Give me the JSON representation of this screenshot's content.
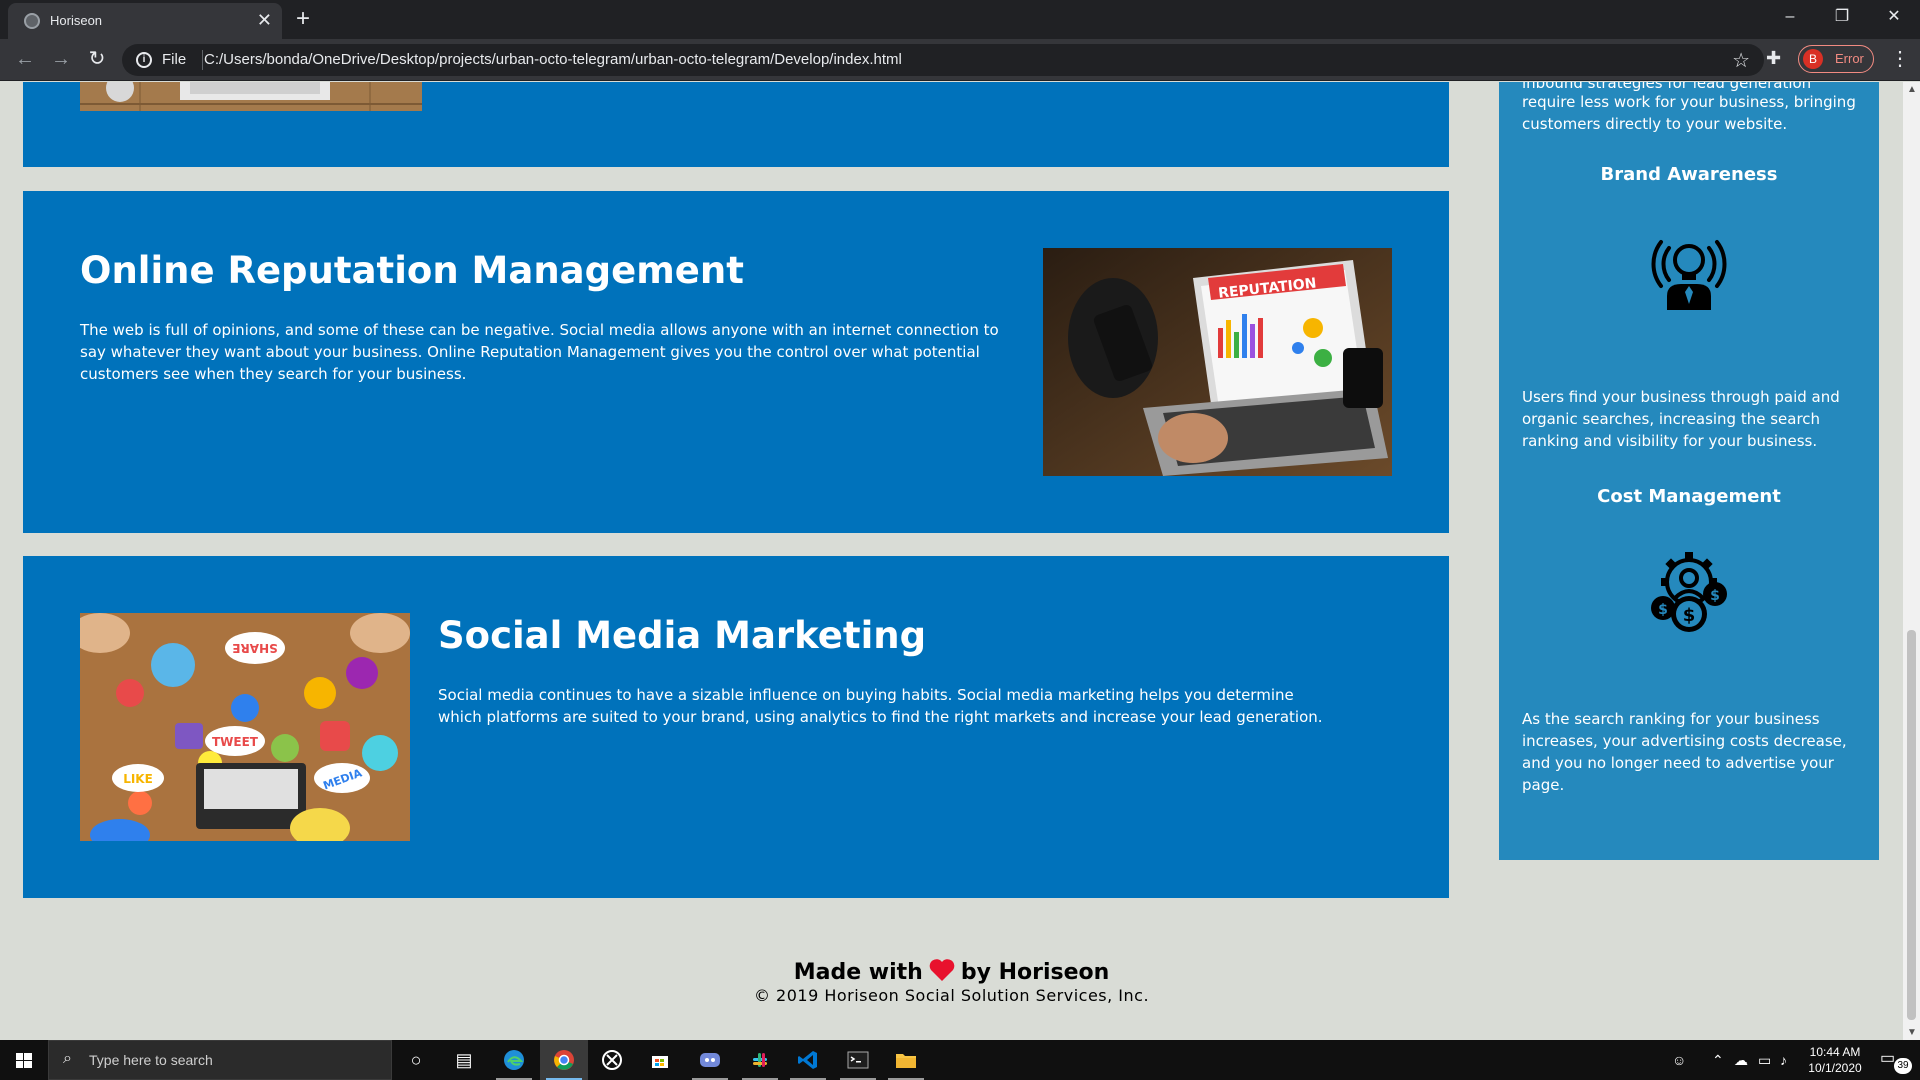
{
  "browser": {
    "tab_title": "Horiseon",
    "file_label": "File",
    "url": "C:/Users/bonda/OneDrive/Desktop/projects/urban-octo-telegram/urban-octo-telegram/Develop/index.html",
    "profile_letter": "B",
    "profile_status": "Error"
  },
  "sections": [
    {
      "title": "Online Reputation Management",
      "body": "The web is full of opinions, and some of these can be negative. Social media allows anyone with an internet connection to say whatever they want about your business. Online Reputation Management gives you the control over what potential customers see when they search for your business.",
      "image_text": "REPUTATION"
    },
    {
      "title": "Social Media Marketing",
      "body": "Social media continues to have a sizable influence on buying habits. Social media marketing helps you determine which platforms are suited to your brand, using analytics to find the right markets and increase your lead generation.",
      "image_words": [
        "SHARE",
        "TWEET",
        "LIKE",
        "MEDIA"
      ]
    }
  ],
  "sidebar": {
    "top_text_cut": "inbound strategies for lead generation",
    "top_text": "require less work for your business, bringing customers directly to your website.",
    "items": [
      {
        "title": "Brand Awareness",
        "icon": "lightbulb-person-icon",
        "body": "Users find your business through paid and organic searches, increasing the search ranking and visibility for your business."
      },
      {
        "title": "Cost Management",
        "icon": "gear-dollar-icon",
        "body": "As the search ranking for your business increases, your advertising costs decrease, and you no longer need to advertise your page."
      }
    ]
  },
  "footer": {
    "made_with": "Made with",
    "by": "by Horiseon",
    "copyright": "© 2019 Horiseon Social Solution Services, Inc."
  },
  "taskbar": {
    "search_placeholder": "Type here to search",
    "time": "10:44 AM",
    "date": "10/1/2020",
    "notification_count": "39"
  },
  "colors": {
    "panel": "#0072bb",
    "sidebar": "#2589bd",
    "page_bg": "#d9dcd6"
  }
}
